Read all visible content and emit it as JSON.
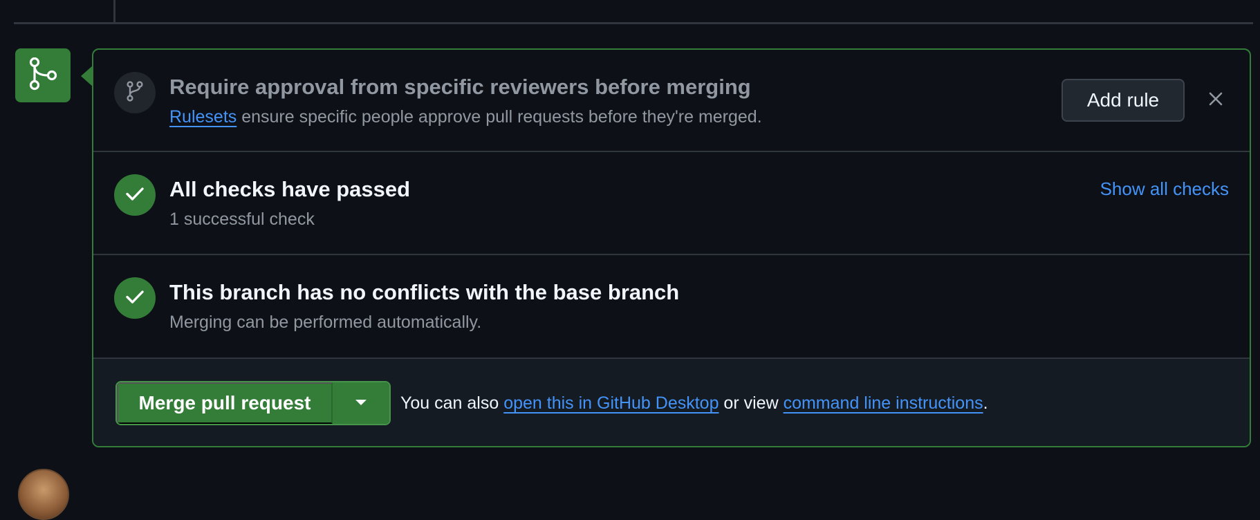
{
  "ruleset_prompt": {
    "title": "Require approval from specific reviewers before merging",
    "link_text": "Rulesets",
    "description_rest": " ensure specific people approve pull requests before they're merged.",
    "add_rule_label": "Add rule",
    "icon": "git-branch-icon",
    "dismiss_icon": "close-icon"
  },
  "checks": {
    "title": "All checks have passed",
    "subtitle": "1 successful check",
    "show_all_label": "Show all checks",
    "icon": "check-icon"
  },
  "conflicts": {
    "title": "This branch has no conflicts with the base branch",
    "subtitle": "Merging can be performed automatically.",
    "icon": "check-icon"
  },
  "merge": {
    "button_label": "Merge pull request",
    "dropdown_icon": "caret-down-icon",
    "note_prefix": "You can also ",
    "desktop_link": "open this in GitHub Desktop",
    "note_middle": " or view ",
    "cli_link": "command line instructions",
    "note_suffix": "."
  },
  "timeline": {
    "badge_icon": "git-merge-icon"
  },
  "colors": {
    "background": "#0d1117",
    "success": "#347d39",
    "link": "#4493f8",
    "border": "#30363d",
    "muted_text": "#9198a1"
  }
}
